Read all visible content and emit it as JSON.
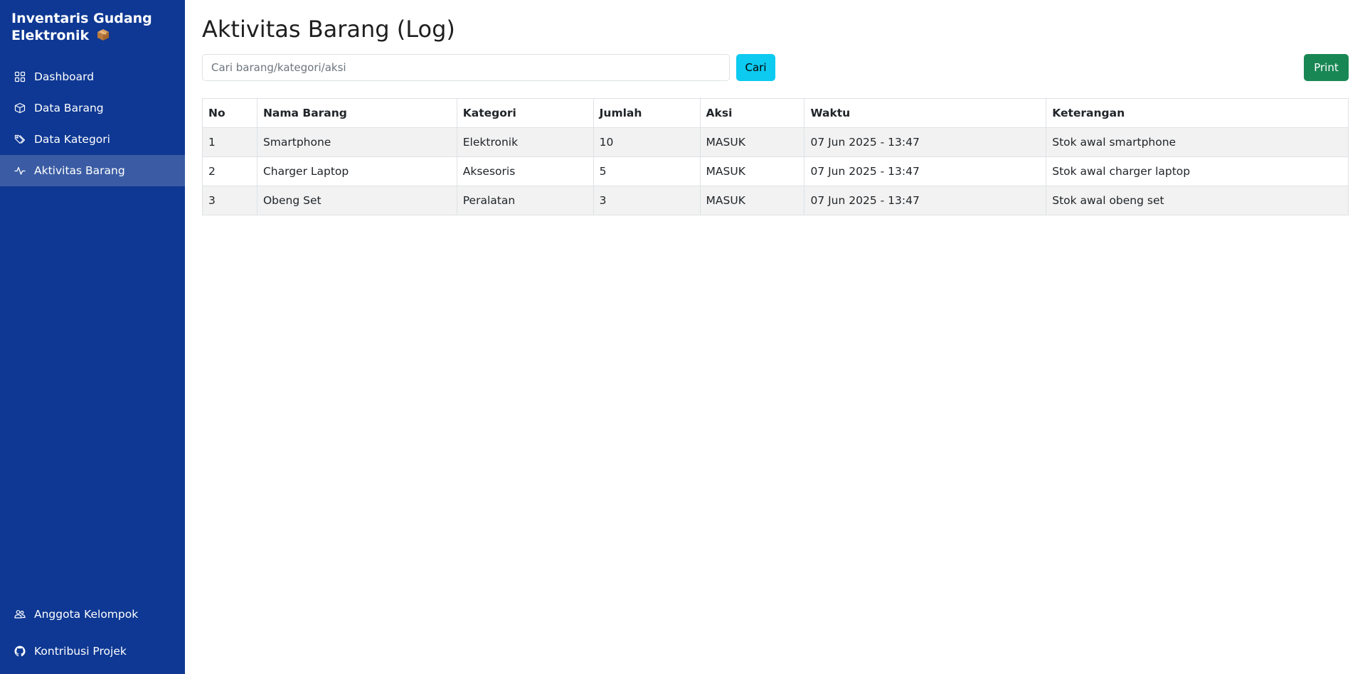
{
  "sidebar": {
    "brand_line1": "Inventaris Gudang",
    "brand_line2": "Elektronik",
    "nav": [
      {
        "label": "Dashboard",
        "icon": "grid-icon",
        "active": false
      },
      {
        "label": "Data Barang",
        "icon": "box-icon",
        "active": false
      },
      {
        "label": "Data Kategori",
        "icon": "tags-icon",
        "active": false
      },
      {
        "label": "Aktivitas Barang",
        "icon": "activity-icon",
        "active": true
      }
    ],
    "bottom": [
      {
        "label": "Anggota Kelompok",
        "icon": "people-icon"
      },
      {
        "label": "Kontribusi Projek",
        "icon": "github-icon"
      }
    ],
    "bg_color": "#0e3893",
    "active_color": "#3b5ca4"
  },
  "main": {
    "title": "Aktivitas Barang (Log)",
    "search": {
      "placeholder": "Cari barang/kategori/aksi",
      "value": ""
    },
    "search_button": "Cari",
    "print_button": "Print",
    "colors": {
      "search_button": "#0dcaf0",
      "print_button": "#198754"
    }
  },
  "table": {
    "headers": [
      "No",
      "Nama Barang",
      "Kategori",
      "Jumlah",
      "Aksi",
      "Waktu",
      "Keterangan"
    ],
    "rows": [
      [
        "1",
        "Smartphone",
        "Elektronik",
        "10",
        "MASUK",
        "07 Jun 2025 - 13:47",
        "Stok awal smartphone"
      ],
      [
        "2",
        "Charger Laptop",
        "Aksesoris",
        "5",
        "MASUK",
        "07 Jun 2025 - 13:47",
        "Stok awal charger laptop"
      ],
      [
        "3",
        "Obeng Set",
        "Peralatan",
        "3",
        "MASUK",
        "07 Jun 2025 - 13:47",
        "Stok awal obeng set"
      ]
    ]
  }
}
